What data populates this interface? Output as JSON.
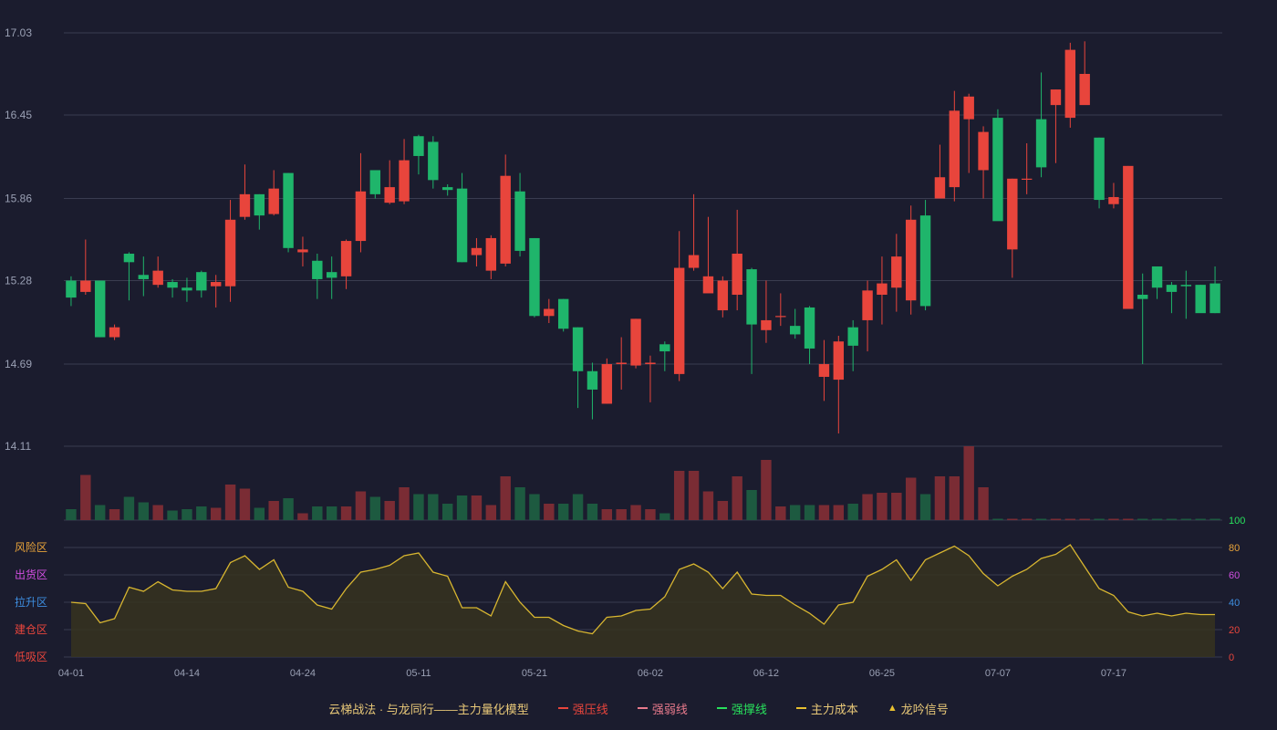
{
  "chart_data": {
    "type": "candlestick",
    "price_axis": {
      "ticks": [
        "17.03",
        "16.45",
        "15.86",
        "15.28",
        "14.69",
        "14.11"
      ],
      "ylim": [
        14.11,
        17.03
      ]
    },
    "x_ticks": [
      "04-01",
      "04-14",
      "04-24",
      "05-11",
      "05-21",
      "06-02",
      "06-12",
      "06-25",
      "07-07",
      "07-17"
    ],
    "x_tick_indices": [
      0,
      8,
      16,
      24,
      32,
      40,
      48,
      56,
      64,
      72
    ],
    "candles": [
      [
        15.28,
        15.16,
        15.31,
        15.1
      ],
      [
        15.2,
        15.28,
        15.57,
        15.18
      ],
      [
        15.28,
        14.88,
        15.28,
        14.88
      ],
      [
        14.88,
        14.95,
        14.97,
        14.86
      ],
      [
        15.47,
        15.41,
        15.48,
        15.14
      ],
      [
        15.32,
        15.29,
        15.45,
        15.17
      ],
      [
        15.25,
        15.35,
        15.45,
        15.23
      ],
      [
        15.27,
        15.23,
        15.29,
        15.16
      ],
      [
        15.23,
        15.21,
        15.3,
        15.13
      ],
      [
        15.34,
        15.21,
        15.35,
        15.16
      ],
      [
        15.24,
        15.27,
        15.32,
        15.09
      ],
      [
        15.24,
        15.71,
        15.85,
        15.13
      ],
      [
        15.73,
        15.89,
        16.1,
        15.71
      ],
      [
        15.89,
        15.74,
        15.89,
        15.64
      ],
      [
        15.75,
        15.93,
        16.06,
        15.74
      ],
      [
        16.04,
        15.51,
        16.04,
        15.48
      ],
      [
        15.48,
        15.5,
        15.59,
        15.38
      ],
      [
        15.42,
        15.29,
        15.47,
        15.15
      ],
      [
        15.34,
        15.3,
        15.45,
        15.15
      ],
      [
        15.31,
        15.56,
        15.57,
        15.22
      ],
      [
        15.56,
        15.91,
        16.18,
        15.48
      ],
      [
        16.06,
        15.89,
        16.06,
        15.86
      ],
      [
        15.83,
        15.94,
        16.13,
        15.82
      ],
      [
        15.84,
        16.13,
        16.28,
        15.82
      ],
      [
        16.3,
        16.16,
        16.31,
        16.03
      ],
      [
        16.26,
        15.99,
        16.3,
        15.93
      ],
      [
        15.94,
        15.92,
        15.96,
        15.88
      ],
      [
        15.93,
        15.41,
        16.04,
        15.41
      ],
      [
        15.46,
        15.51,
        15.58,
        15.38
      ],
      [
        15.35,
        15.58,
        15.6,
        15.29
      ],
      [
        15.4,
        16.02,
        16.17,
        15.38
      ],
      [
        15.91,
        15.49,
        16.04,
        15.45
      ],
      [
        15.58,
        15.03,
        15.58,
        15.02
      ],
      [
        15.03,
        15.08,
        15.15,
        14.98
      ],
      [
        15.15,
        14.94,
        15.15,
        14.92
      ],
      [
        14.95,
        14.64,
        14.95,
        14.38
      ],
      [
        14.64,
        14.51,
        14.7,
        14.3
      ],
      [
        14.41,
        14.69,
        14.73,
        14.41
      ],
      [
        14.69,
        14.7,
        14.88,
        14.51
      ],
      [
        14.68,
        15.01,
        15.01,
        14.66
      ],
      [
        14.69,
        14.7,
        14.75,
        14.42
      ],
      [
        14.83,
        14.78,
        14.85,
        14.64
      ],
      [
        14.62,
        15.37,
        15.63,
        14.57
      ],
      [
        15.37,
        15.46,
        15.89,
        15.35
      ],
      [
        15.19,
        15.31,
        15.73,
        15.21
      ],
      [
        15.07,
        15.28,
        15.31,
        15.02
      ],
      [
        15.18,
        15.47,
        15.78,
        15.07
      ],
      [
        15.36,
        14.97,
        15.37,
        14.62
      ],
      [
        14.93,
        15.0,
        15.28,
        14.84
      ],
      [
        15.03,
        15.03,
        15.19,
        14.96
      ],
      [
        14.96,
        14.9,
        15.08,
        14.87
      ],
      [
        15.09,
        14.8,
        15.1,
        14.69
      ],
      [
        14.6,
        14.69,
        14.86,
        14.43
      ],
      [
        14.58,
        14.85,
        14.89,
        14.2
      ],
      [
        14.95,
        14.82,
        15.0,
        14.64
      ],
      [
        15.0,
        15.21,
        15.28,
        14.78
      ],
      [
        15.18,
        15.26,
        15.45,
        14.97
      ],
      [
        15.23,
        15.45,
        15.61,
        15.06
      ],
      [
        15.14,
        15.71,
        15.81,
        15.04
      ],
      [
        15.74,
        15.1,
        15.85,
        15.07
      ],
      [
        15.86,
        16.01,
        16.24,
        15.86
      ],
      [
        15.94,
        16.48,
        16.62,
        15.84
      ],
      [
        16.42,
        16.58,
        16.6,
        16.04
      ],
      [
        16.06,
        16.33,
        16.37,
        15.86
      ],
      [
        16.43,
        15.7,
        16.49,
        15.76
      ],
      [
        15.5,
        16.0,
        16.0,
        15.3
      ],
      [
        16.0,
        16.0,
        16.25,
        15.89
      ],
      [
        16.42,
        16.08,
        16.75,
        16.01
      ],
      [
        16.52,
        16.63,
        16.63,
        16.11
      ],
      [
        16.43,
        16.91,
        16.96,
        16.36
      ],
      [
        16.52,
        16.74,
        16.97,
        16.53
      ],
      [
        16.29,
        15.85,
        16.29,
        15.79
      ],
      [
        15.82,
        15.87,
        15.97,
        15.79
      ],
      [
        15.08,
        16.09,
        16.09,
        15.08
      ],
      [
        15.18,
        15.15,
        15.33,
        14.69
      ],
      [
        15.38,
        15.23,
        15.38,
        15.15
      ],
      [
        15.25,
        15.2,
        15.27,
        15.05
      ],
      [
        15.25,
        15.24,
        15.35,
        15.01
      ],
      [
        15.25,
        15.05,
        15.25,
        15.07
      ],
      [
        15.26,
        15.05,
        15.38,
        15.05
      ]
    ],
    "volume": [
      8,
      33,
      11,
      8,
      17,
      13,
      11,
      7,
      8,
      10,
      9,
      26,
      23,
      9,
      14,
      16,
      5,
      10,
      10,
      10,
      21,
      17,
      14,
      24,
      19,
      19,
      12,
      18,
      18,
      11,
      32,
      24,
      19,
      12,
      12,
      19,
      12,
      8,
      8,
      11,
      8,
      5,
      36,
      36,
      21,
      14,
      32,
      22,
      44,
      10,
      11,
      11,
      11,
      11,
      12,
      19,
      20,
      20,
      31,
      19,
      32,
      32,
      54,
      24,
      1,
      1,
      1,
      1,
      1,
      1,
      1,
      1,
      1,
      1,
      1,
      1,
      1,
      1,
      1,
      1
    ],
    "indicator": {
      "ylim": [
        0,
        100
      ],
      "ticks": [
        "0",
        "20",
        "40",
        "60",
        "80",
        "100"
      ],
      "zones": [
        "风险区",
        "出货区",
        "拉升区",
        "建仓区",
        "低吸区"
      ],
      "values": [
        40,
        39,
        25,
        28,
        51,
        48,
        55,
        49,
        48,
        48,
        50,
        69,
        74,
        64,
        71,
        51,
        48,
        38,
        35,
        50,
        62,
        64,
        67,
        74,
        76,
        62,
        59,
        36,
        36,
        30,
        55,
        40,
        29,
        29,
        23,
        19,
        17,
        29,
        30,
        34,
        35,
        44,
        64,
        68,
        62,
        50,
        62,
        46,
        45,
        45,
        38,
        32,
        24,
        38,
        40,
        59,
        64,
        71,
        56,
        71,
        76,
        81,
        74,
        61,
        52,
        59,
        64,
        72,
        75,
        82,
        66,
        50,
        45,
        33,
        30,
        32,
        30,
        32,
        31,
        31
      ]
    },
    "series": [
      {
        "name": "云梯战法 · 与龙同行——主力量化模型"
      },
      {
        "name": "强压线"
      },
      {
        "name": "强弱线"
      },
      {
        "name": "强撑线"
      },
      {
        "name": "主力成本"
      },
      {
        "name": "龙吟信号"
      }
    ],
    "colors": {
      "up": "#e8453c",
      "down": "#1fb56b",
      "vol_up": "#7a2c34",
      "vol_down": "#1d5a40",
      "grid": "#3a3c50",
      "axis_text": "#9aa0b4",
      "indicator_line": "#d8b630",
      "indicator_fill": "#36331f",
      "zone_yellow": "#e8a33a",
      "zone_magenta": "#d04ee0",
      "zone_blue": "#3e8ee0",
      "zone_red": "#e8453c",
      "tick_green": "#28e05c",
      "tick_red": "#e8453c",
      "tick_blue": "#3e8ee0",
      "tick_magenta": "#d04ee0",
      "tick_yellow": "#e8a33a",
      "legend_text": "#e8c878",
      "legend_red": "#e8453c",
      "legend_pink": "#e87a8c",
      "legend_green": "#28e05c",
      "legend_yellow": "#e8c030"
    }
  }
}
